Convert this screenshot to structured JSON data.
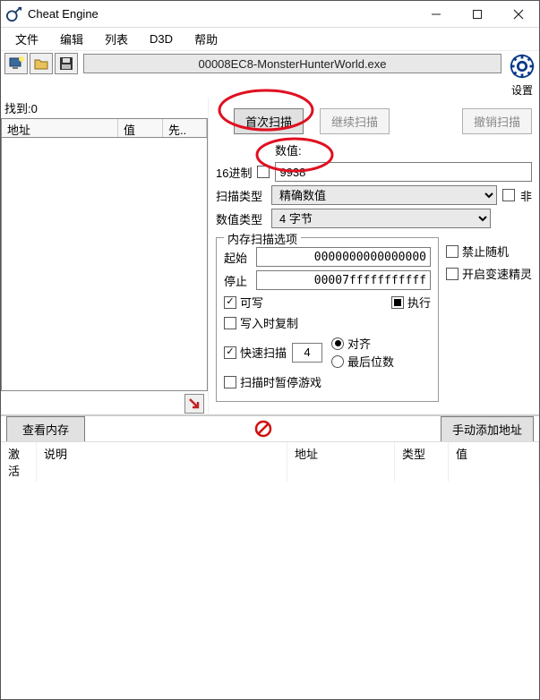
{
  "window": {
    "title": "Cheat Engine"
  },
  "menu": {
    "items": [
      "文件",
      "编辑",
      "列表",
      "D3D",
      "帮助"
    ]
  },
  "process": {
    "name": "00008EC8-MonsterHunterWorld.exe"
  },
  "settings_label": "设置",
  "found": {
    "label": "找到:",
    "count": "0"
  },
  "results_columns": {
    "addr": "地址",
    "value": "值",
    "prev": "先.."
  },
  "scan_buttons": {
    "first": "首次扫描",
    "next": "继续扫描",
    "undo": "撤销扫描"
  },
  "value": {
    "label": "数值:",
    "input": "9938"
  },
  "hex": {
    "label": "16进制"
  },
  "scan_type": {
    "label": "扫描类型",
    "value": "精确数值"
  },
  "not_flag": "非",
  "value_type": {
    "label": "数值类型",
    "value": "4 字节"
  },
  "mem_opts": {
    "legend": "内存扫描选项",
    "start_label": "起始",
    "start_value": "0000000000000000",
    "stop_label": "停止",
    "stop_value": "00007fffffffffff",
    "writable": "可写",
    "exec": "执行",
    "cow": "写入时复制",
    "fastscan": "快速扫描",
    "fastscan_val": "4",
    "align": "对齐",
    "lastdigits": "最后位数",
    "pause": "扫描时暂停游戏"
  },
  "side_opts": {
    "no_random": "禁止随机",
    "enable_speedhack": "开启变速精灵"
  },
  "midbar": {
    "view_memory": "查看内存",
    "add_manual": "手动添加地址"
  },
  "table_cols": {
    "active": "激活",
    "desc": "说明",
    "addr": "地址",
    "type": "类型",
    "value": "值"
  }
}
